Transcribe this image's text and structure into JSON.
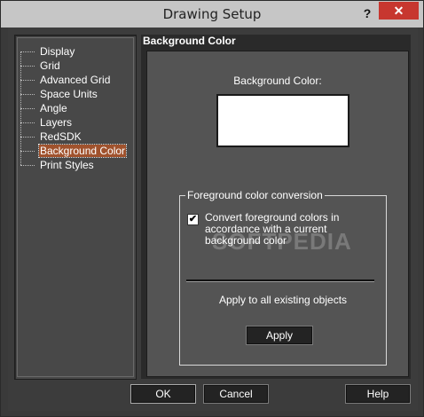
{
  "window": {
    "title": "Drawing Setup",
    "help_glyph": "?",
    "close_glyph": "✕"
  },
  "tree": {
    "items": [
      {
        "label": "Display"
      },
      {
        "label": "Grid"
      },
      {
        "label": "Advanced Grid"
      },
      {
        "label": "Space Units"
      },
      {
        "label": "Angle"
      },
      {
        "label": "Layers"
      },
      {
        "label": "RedSDK"
      },
      {
        "label": "Background Color"
      },
      {
        "label": "Print Styles"
      }
    ],
    "selected": "Background Color"
  },
  "panel": {
    "header": "Background Color",
    "bg_label": "Background Color:",
    "swatch_color": "#ffffff",
    "group_title": "Foreground color conversion",
    "checkbox_checked": true,
    "checkbox_text": "Convert foreground colors in accordance with a current background color",
    "apply_all_label": "Apply to all existing objects",
    "apply_button": "Apply"
  },
  "buttons": {
    "ok": "OK",
    "cancel": "Cancel",
    "help": "Help"
  },
  "watermark": "SOFTPEDIA"
}
